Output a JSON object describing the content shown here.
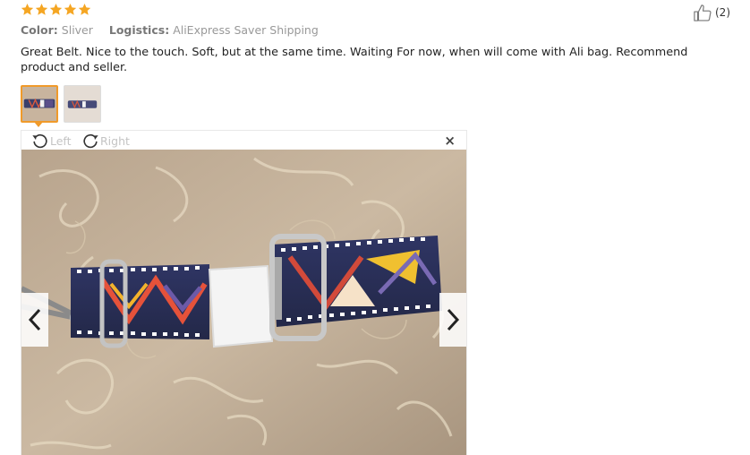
{
  "rating": {
    "stars": 5,
    "star_color": "#f5a623",
    "star_icon": "star-icon"
  },
  "helpful": {
    "count": "(2)",
    "icon": "thumbs-up-icon"
  },
  "meta": {
    "color_label": "Color:",
    "color_value": "Sliver",
    "logistics_label": "Logistics:",
    "logistics_value": "AliExpress Saver Shipping"
  },
  "review": {
    "text": "Great Belt. Nice to the touch. Soft, but at the same time. Waiting For now, when will come with Ali bag. Recommend product and seller."
  },
  "thumbnails": {
    "count": 2,
    "active_index": 0,
    "active_border_color": "#f09a2a"
  },
  "viewer": {
    "rotate_left_label": "Left",
    "rotate_right_label": "Right",
    "close_label": "×",
    "prev_icon": "chevron-left-icon",
    "next_icon": "chevron-right-icon"
  }
}
